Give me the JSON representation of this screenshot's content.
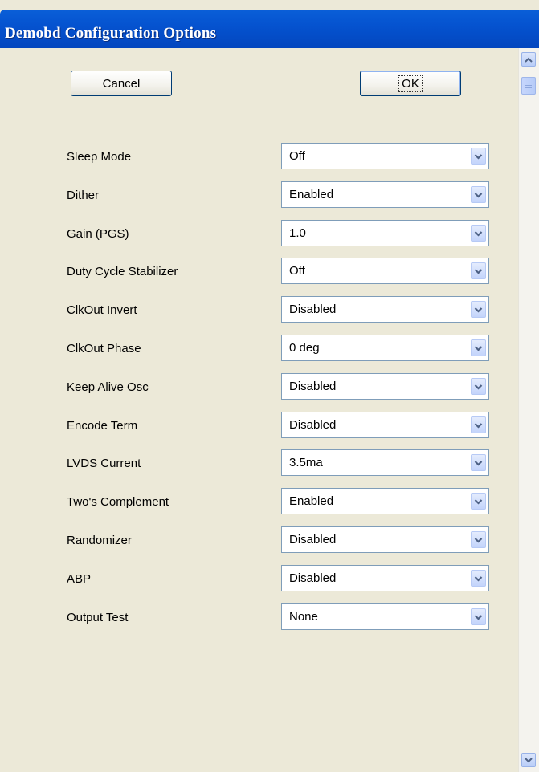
{
  "window": {
    "title": "Demobd Configuration Options"
  },
  "buttons": {
    "cancel": "Cancel",
    "ok": "OK"
  },
  "options": [
    {
      "label": "Sleep Mode",
      "value": "Off"
    },
    {
      "label": "Dither",
      "value": "Enabled"
    },
    {
      "label": "Gain (PGS)",
      "value": "1.0"
    },
    {
      "label": "Duty Cycle Stabilizer",
      "value": "Off"
    },
    {
      "label": "ClkOut Invert",
      "value": "Disabled"
    },
    {
      "label": "ClkOut Phase",
      "value": "0 deg"
    },
    {
      "label": "Keep Alive Osc",
      "value": "Disabled"
    },
    {
      "label": "Encode Term",
      "value": "Disabled"
    },
    {
      "label": "LVDS Current",
      "value": "3.5ma"
    },
    {
      "label": "Two's Complement",
      "value": "Enabled"
    },
    {
      "label": "Randomizer",
      "value": "Disabled"
    },
    {
      "label": "ABP",
      "value": "Disabled"
    },
    {
      "label": "Output Test",
      "value": "None"
    }
  ],
  "icons": {
    "dropdown": "chevron-down-icon",
    "scroll_up": "chevron-up-icon",
    "scroll_down": "chevron-down-icon"
  },
  "colors": {
    "titlebar": "#0553d0",
    "dialog_background": "#ece9d8",
    "field_border": "#7f9db9",
    "arrow_glyph": "#4d6185"
  }
}
